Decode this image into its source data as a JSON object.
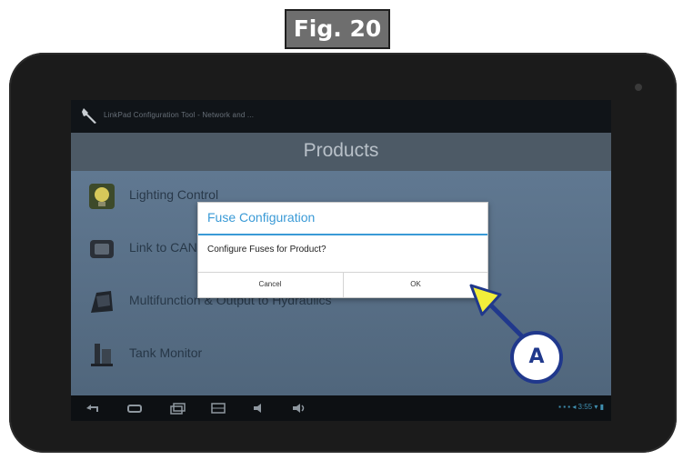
{
  "figure": {
    "label": "Fig. 20"
  },
  "status_bar": {
    "app_title": "LinkPad Configuration Tool - Network and ..."
  },
  "title_bar": {
    "title": "Products"
  },
  "products": [
    {
      "label": "Lighting Control",
      "icon": "bulb-icon"
    },
    {
      "label": "Link to CAN",
      "icon": "link-icon"
    },
    {
      "label": "Multifunction & Output to Hydraulics",
      "icon": "multifunction-icon"
    },
    {
      "label": "Tank Monitor",
      "icon": "tank-icon"
    }
  ],
  "dialog": {
    "title": "Fuse Configuration",
    "message": "Configure Fuses for Product?",
    "cancel_label": "Cancel",
    "ok_label": "OK"
  },
  "callout": {
    "label": "A",
    "color": "#20388c",
    "arrow_color": "#f2ee3a"
  },
  "nav_bar": {
    "icons": [
      "back-icon",
      "home-icon",
      "recent-apps-icon",
      "screenshot-icon",
      "volume-down-icon",
      "volume-up-icon"
    ],
    "tray_text": "▪ ▪ ▪ ◂ 3:55 ▾ ▮"
  }
}
